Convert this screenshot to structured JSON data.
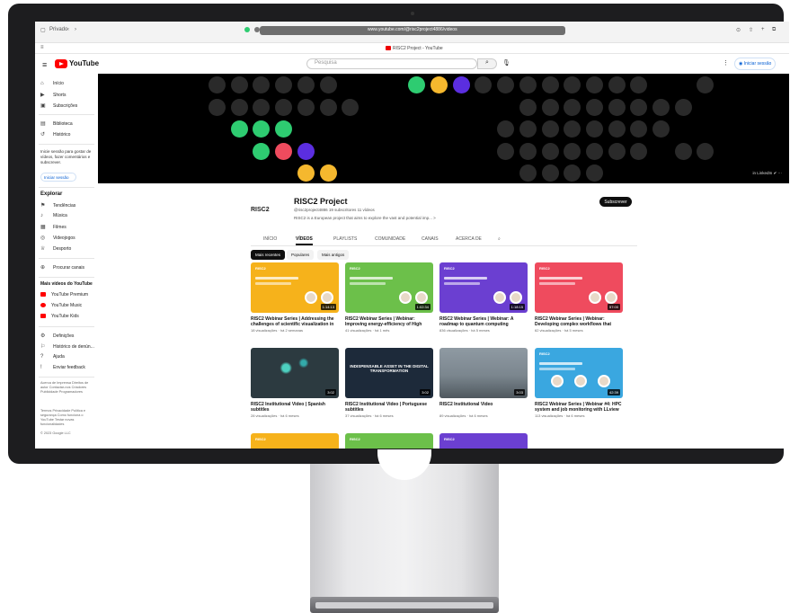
{
  "browser": {
    "private_label": "Privado",
    "url": "www.youtube.com/@risc2project4886/videos",
    "tab_title": "RISC2 Project - YouTube"
  },
  "header": {
    "logo_text": "YouTube",
    "search_placeholder": "Pesquisa",
    "signin_label": "Iniciar sessão"
  },
  "sidebar": {
    "items_top": [
      {
        "icon": "home-icon",
        "glyph": "⌂",
        "label": "Início"
      },
      {
        "icon": "shorts-icon",
        "glyph": "▶",
        "label": "Shorts"
      },
      {
        "icon": "subscriptions-icon",
        "glyph": "▣",
        "label": "Subscrições"
      }
    ],
    "items_lib": [
      {
        "icon": "library-icon",
        "glyph": "▤",
        "label": "Biblioteca"
      },
      {
        "icon": "history-icon",
        "glyph": "↺",
        "label": "Histórico"
      }
    ],
    "signin_note": "Inicie sessão para gostar de vídeos, fazer comentários e subscrever.",
    "signin_label": "Iniciar sessão",
    "explore_title": "Explorar",
    "explore_items": [
      {
        "icon": "trending-icon",
        "glyph": "⚑",
        "label": "Tendências"
      },
      {
        "icon": "music-icon",
        "glyph": "♪",
        "label": "Música"
      },
      {
        "icon": "film-icon",
        "glyph": "▦",
        "label": "Filmes"
      },
      {
        "icon": "gaming-icon",
        "glyph": "◎",
        "label": "Videojogos"
      },
      {
        "icon": "sports-icon",
        "glyph": "♕",
        "label": "Desporto"
      }
    ],
    "browse_channels": "Procurar canais",
    "more_title": "Mais vídeos do YouTube",
    "more_items": [
      "YouTube Premium",
      "YouTube Music",
      "YouTube Kids"
    ],
    "settings_items": [
      {
        "icon": "settings-icon",
        "glyph": "⚙",
        "label": "Definições"
      },
      {
        "icon": "flag-icon",
        "glyph": "⚐",
        "label": "Histórico de denún..."
      },
      {
        "icon": "help-icon",
        "glyph": "?",
        "label": "Ajuda"
      },
      {
        "icon": "feedback-icon",
        "glyph": "!",
        "label": "Enviar feedback"
      }
    ],
    "footer_1": "Acerca de  Imprensa  Direitos de autor  Contactar-nos  Criadores  Publicidade  Programadores",
    "footer_2": "Termos  Privacidade  Política e segurança  Como funciona o YouTube  Testar novas funcionalidades",
    "footer_3": "© 2023 Google LLC"
  },
  "banner": {
    "links": "in LinkedIn   ✔   ⋯"
  },
  "channel": {
    "logo_text": "RISC2",
    "name": "RISC2 Project",
    "meta": "@risc2project4886   19 subscritores   11 vídeos",
    "description": "RISC2 is a European project that aims to explore the vast and potential imp...   >",
    "subscribe_label": "Subscrever"
  },
  "tabs": [
    "INÍCIO",
    "VÍDEOS",
    "PLAYLISTS",
    "COMUNIDADE",
    "CANAIS",
    "ACERCA DE"
  ],
  "chips": [
    "Mais recentes",
    "Populares",
    "Mais antigos"
  ],
  "videos": [
    {
      "title": "RISC2 Webinar Series | Addressing the challenges of scientific visualization in the...",
      "meta": "18 visualizações · há 2 semanas",
      "duration": "1:14:13",
      "color": "#f6b21b"
    },
    {
      "title": "RISC2 Webinar Series | Webinar: Improving energy-efficiency of High Performance...",
      "meta": "41 visualizações · há 1 mês",
      "duration": "1:02:34",
      "color": "#6cc04a"
    },
    {
      "title": "RISC2 Webinar Series | Webinar: A roadmap to quantum computing integration into HP...",
      "meta": "836 visualizações · há 5 meses",
      "duration": "1:18:15",
      "color": "#6b3fd1"
    },
    {
      "title": "RISC2 Webinar Series | Webinar: Developing complex workflows that include HPC, AI an...",
      "meta": "62 visualizações · há 5 meses",
      "duration": "57:00",
      "color": "#ef4b5e"
    },
    {
      "title": "RISC2 Institutional Video | Spanish subtitles",
      "meta": "28 visualizações · há 6 meses",
      "duration": "3:02",
      "color": "#3f4a52"
    },
    {
      "title": "RISC2 Institutional Video | Portuguese subtitles",
      "meta": "37 visualizações · há 6 meses",
      "duration": "3:02",
      "color": "#1d2a3a"
    },
    {
      "title": "RISC2 Institutional Video",
      "meta": "89 visualizações · há 6 meses",
      "duration": "3:03",
      "color": "#6f7d86"
    },
    {
      "title": "RISC2 Webinar Series | Webinar #4: HPC system and job monitoring with LLview",
      "meta": "113 visualizações · há 6 meses",
      "duration": "42:39",
      "color": "#3aa7e0"
    },
    {
      "title": "",
      "meta": "",
      "duration": "",
      "color": "#f6b21b"
    },
    {
      "title": "",
      "meta": "",
      "duration": "",
      "color": "#6cc04a"
    },
    {
      "title": "",
      "meta": "",
      "duration": "",
      "color": "#6b3fd1"
    }
  ],
  "video_centers": {
    "v5": "INDISPENSABLE ASSET IN THE DIGITAL TRANSFORMATION"
  },
  "thumb_brand": "RISC2"
}
